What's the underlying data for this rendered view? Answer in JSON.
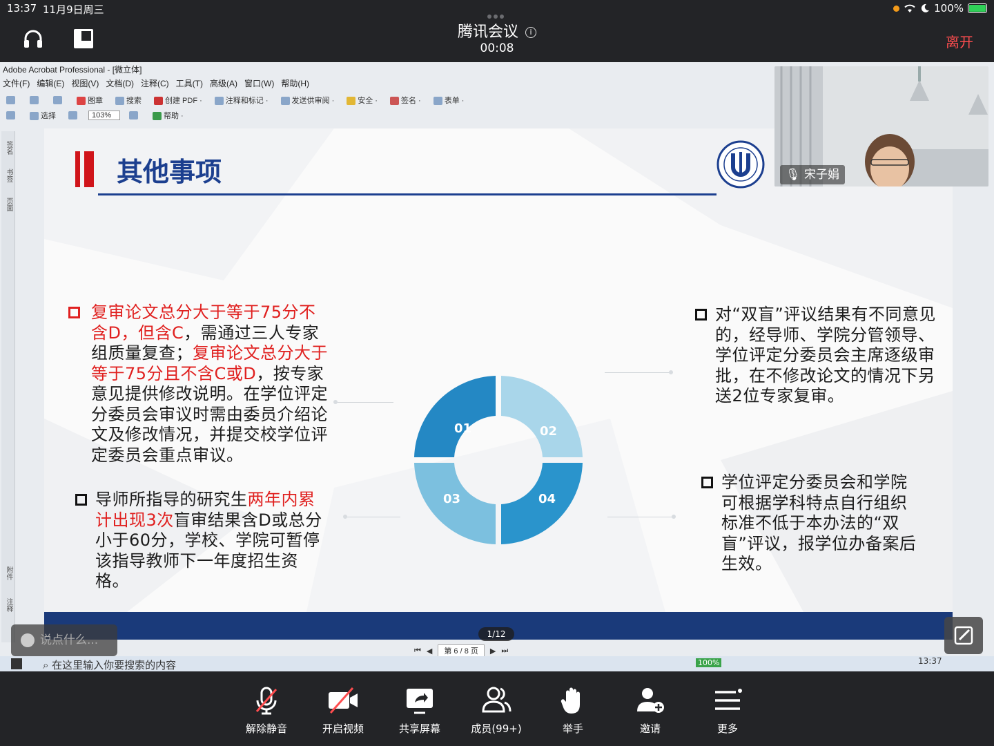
{
  "status_bar": {
    "time": "13:37",
    "date": "11月9日周三",
    "battery": "100%"
  },
  "meeting": {
    "title": "腾讯会议",
    "timer": "00:08",
    "leave_label": "离开"
  },
  "acrobat": {
    "window_title": "Adobe Acrobat Professional - [微立体]",
    "menu": [
      "文件(F)",
      "编辑(E)",
      "视图(V)",
      "文档(D)",
      "注释(C)",
      "工具(T)",
      "高级(A)",
      "窗口(W)",
      "帮助(H)"
    ],
    "toolbar1": [
      "图章",
      "搜索",
      "创建 PDF ·",
      "注释和标记 ·",
      "发送供审阅 ·",
      "安全 ·",
      "签名 ·",
      "表单 ·"
    ],
    "toolbar2": [
      "选择",
      "帮助 ·"
    ],
    "zoom": "103%",
    "page_indicator": "第 6 / 8 页",
    "side_labels": [
      "签名",
      "书签",
      "页面",
      "附件",
      "注释"
    ]
  },
  "slide": {
    "title": "其他事项",
    "segments": [
      "01",
      "02",
      "03",
      "04"
    ],
    "colors": {
      "dark": "#2488c4",
      "light": "#a9d6ea",
      "title_blue": "#1c3f8f",
      "accent_red": "#e0201f"
    },
    "p1": {
      "r1": "复审论文总分大于等于75分不含D，但含C",
      "n1": "，需通过三人专家组质量复查；",
      "r2": "复审论文总分大于等于75分且不含C或D",
      "n2": "，按专家意见提供修改说明。在学位评定分委员会审议时需由委员介绍论文及修改情况，并提交校学位评定委员会重点审议。"
    },
    "p2": {
      "n1": "导师所指导的研究生",
      "r1": "两年内累计出现3次",
      "n2": "盲审结果含D或总分小于60分，学校、学院可暂停该指导教师下一年度招生资格。"
    },
    "p3": "对“双盲”评议结果有不同意见的，经导师、学院分管领导、学位评定分委员会主席逐级审批，在不修改论文的情况下另送2位专家复审。",
    "p4": "学位评定分委员会和学院可根据学科特点自行组织标准不低于本办法的“双盲”评议，报学位办备案后生效。"
  },
  "video": {
    "participant_name": "宋子娟"
  },
  "overlay": {
    "chat_placeholder": "说点什么...",
    "page_counter": "1/12"
  },
  "taskbar": {
    "search_placeholder": "在这里输入你要搜索的内容",
    "clock": "13:37",
    "battery": "100%"
  },
  "controls": [
    {
      "label": "解除静音",
      "icon": "mic-muted-icon"
    },
    {
      "label": "开启视频",
      "icon": "video-off-icon"
    },
    {
      "label": "共享屏幕",
      "icon": "share-screen-icon"
    },
    {
      "label": "成员(99+)",
      "icon": "members-icon"
    },
    {
      "label": "举手",
      "icon": "raise-hand-icon"
    },
    {
      "label": "邀请",
      "icon": "invite-icon"
    },
    {
      "label": "更多",
      "icon": "more-icon"
    }
  ]
}
